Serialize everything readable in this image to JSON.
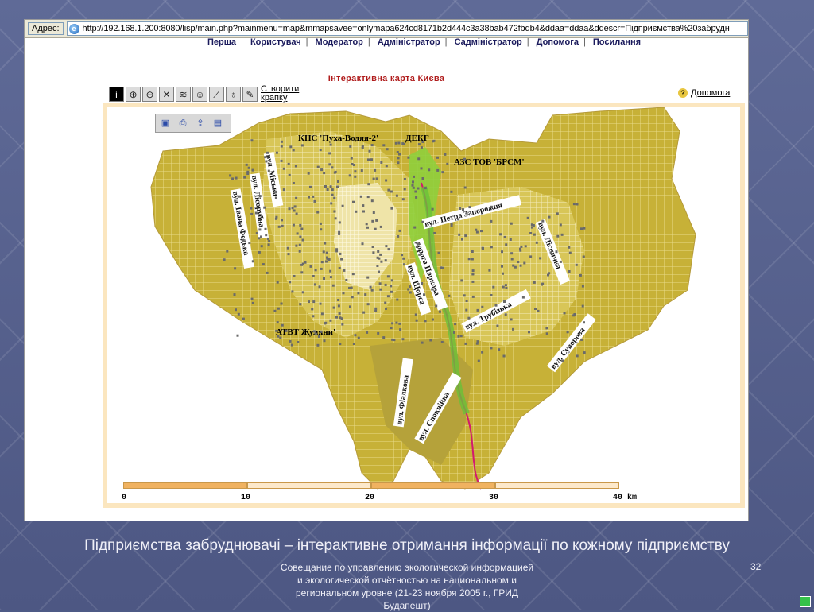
{
  "browser": {
    "address_label": "Адрес:",
    "url": "http://192.168.1.200:8080/lisp/main.php?mainmenu=map&mmapsavee=onlymapa624cd8171b2d444c3a38bab472fbdb4&ddaa=ddaa&ddescr=Підприємства%20забрудн"
  },
  "menu": {
    "items": [
      "Перша",
      "Користувач",
      "Модератор",
      "Адміністратор",
      "Садміністратор",
      "Допомога",
      "Посилання"
    ]
  },
  "map": {
    "title": "Інтерактивна карта Києва",
    "create_point": "Створити крапку",
    "help": "Допомога",
    "callouts": {
      "kns": "КНС 'Пуха-Водяя-2'",
      "dekg": "ДЕКГ",
      "azs": "АЗС ТОВ 'БРСМ'",
      "atvt": "АТВТ'Жуляни'"
    },
    "streets": {
      "miska": "вул. Міська",
      "lisorubna": "вул. Лісорубна",
      "ivana_fedka": "вул. Івана Федька",
      "petra_zaporozhtsya": "вул. Петра Запорожця",
      "lisnycha": "вул. Лісничка",
      "doroha_parkova": "дорога Паркова",
      "shchorsa": "вул. Щорса",
      "trubizka": "вул. Трубізька",
      "suvorova": "вул. Суворова",
      "fialkova": "вул. Фіалкова",
      "spokiyna": "вул. Споквійна"
    },
    "scale": {
      "labels": [
        "0",
        "10",
        "20",
        "30",
        "40 km"
      ]
    },
    "colors": {
      "urban": "#c7b137",
      "suburb": "#b5a23a",
      "water": "#d21a6e",
      "green": "#8fcf3c",
      "point": "#6a6a6a"
    }
  },
  "slide": {
    "caption": "Підприємства забруднювачі – інтерактивне отримання інформації по кожному підприємству",
    "footer": "Совещание по управлению экологической информацией и экологической отчётностью на национальном и региональном уровне (21-23 ноября 2005 г., ГРИД Будапешт)",
    "page_number": "32"
  }
}
